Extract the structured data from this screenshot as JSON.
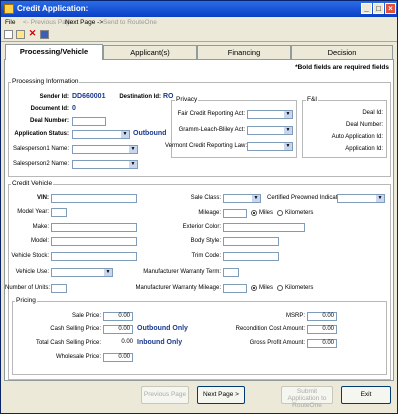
{
  "window": {
    "title": "Credit Application:"
  },
  "menu": {
    "file": "File",
    "prev": "<- Previous Page",
    "next": "Next Page ->",
    "send": "Send to RouteOne"
  },
  "tabs": [
    "Processing/Vehicle",
    "Applicant(s)",
    "Financing",
    "Decision"
  ],
  "required_note": "*Bold fields are required fields",
  "processing": {
    "group": "Processing Information",
    "sender_label": "Sender Id:",
    "sender_value": "DD660001",
    "destination_label": "Destination Id:",
    "destination_value": "RO",
    "document_label": "Document Id:",
    "document_value": "0",
    "deal_number_label": "Deal Number:",
    "app_status_label": "Application Status:",
    "app_status_value": "Outbound",
    "sp1_label": "Salesperson1 Name:",
    "sp2_label": "Salesperson2 Name:"
  },
  "privacy": {
    "group": "Privacy",
    "fcra": "Fair Credit Reporting Act:",
    "glba": "Gramm-Leach-Bliley Act:",
    "vt": "Vermont Credit Reporting Law:"
  },
  "fandi": {
    "group": "F&I",
    "deal_id": "Deal Id:",
    "deal_number": "Deal Number:",
    "auto_app_id": "Auto Application Id:",
    "app_id": "Application Id:"
  },
  "vehicle": {
    "group": "Credit Vehicle",
    "vin": "VIN:",
    "model_year": "Model Year:",
    "make": "Make:",
    "model": "Model:",
    "stock": "Vehicle Stock:",
    "use": "Vehicle Use:",
    "units": "Number of Units:",
    "sale_class": "Sale Class:",
    "cpo": "Certified Preowned Indicator:",
    "mileage": "Mileage:",
    "miles": "Miles",
    "km": "Kilometers",
    "ext_color": "Exterior Color:",
    "body": "Body Style:",
    "trim": "Trim Code:",
    "mfr_term": "Manufacturer Warranty Term:",
    "mfr_mileage": "Manufacturer Warranty Mileage:"
  },
  "pricing": {
    "group": "Pricing",
    "sale_price_label": "Sale Price:",
    "sale_price": "0.00",
    "cash_selling_label": "Cash Selling Price:",
    "cash_selling": "0.00",
    "cash_selling_note": "Outbound Only",
    "total_cash_label": "Total Cash Selling Price:",
    "total_cash": "0.00",
    "total_cash_note": "Inbound Only",
    "wholesale_label": "Wholesale Price:",
    "wholesale": "0.00",
    "msrp_label": "MSRP:",
    "msrp": "0.00",
    "recon_label": "Recondition Cost Amount:",
    "recon": "0.00",
    "gross_label": "Gross Profit Amount:",
    "gross": "0.00"
  },
  "buttons": {
    "prev": "Previous Page",
    "next": "Next Page >",
    "submit_1": "Submit Application to",
    "submit_2": "RouteOne",
    "exit": "Exit"
  }
}
